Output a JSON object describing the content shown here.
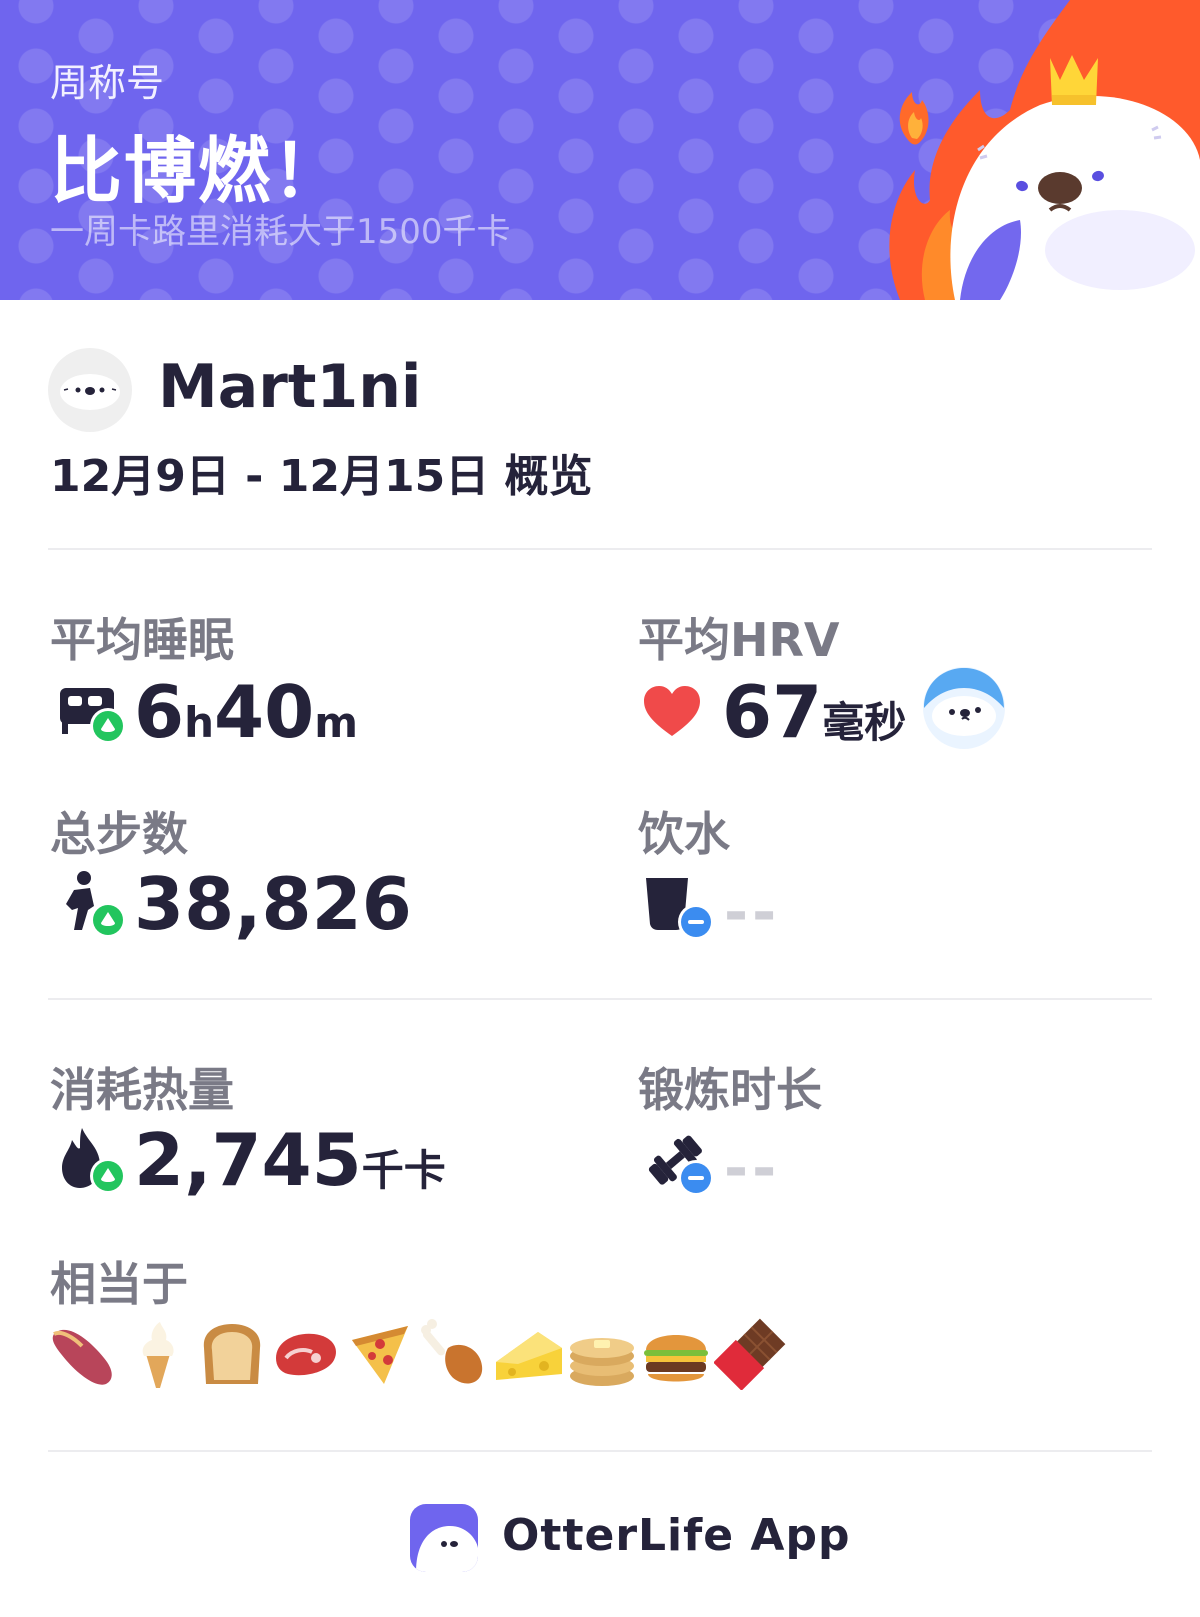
{
  "badge": {
    "kicker": "周称号",
    "title": "比博燃！",
    "description": "一周卡路里消耗大于1500千卡"
  },
  "profile": {
    "username": "Mart1ni",
    "date_range": "12月9日 - 12月15日 概览"
  },
  "stats": {
    "sleep": {
      "label": "平均睡眠",
      "h": "6",
      "h_unit": "h",
      "m": "40",
      "m_unit": "m",
      "trend_icon": "trend-up-badge"
    },
    "hrv": {
      "label": "平均HRV",
      "value": "67",
      "unit": "毫秒",
      "icon": "heart-icon"
    },
    "steps": {
      "label": "总步数",
      "value": "38,826",
      "trend_icon": "trend-up-badge"
    },
    "water": {
      "label": "饮水",
      "value": "--",
      "trend_icon": "neutral-badge"
    },
    "calories": {
      "label": "消耗热量",
      "value": "2,745",
      "unit": "千卡",
      "trend_icon": "trend-up-badge"
    },
    "workout": {
      "label": "锻炼时长",
      "value": "--",
      "trend_icon": "neutral-badge"
    }
  },
  "equivalent": {
    "label": "相当于",
    "foods": [
      "sweet-potato",
      "soft-ice-cream",
      "bread",
      "steak",
      "pizza",
      "chicken-leg",
      "cheese",
      "pancakes",
      "hamburger",
      "chocolate-bar"
    ]
  },
  "footer": {
    "app_name": "OtterLife App"
  },
  "colors": {
    "banner_bg": "#6f65ee",
    "text_dark": "#25233a",
    "label_gray": "#7a7a86",
    "trend_up_green": "#22c55e",
    "neutral_blue": "#3b8cf0",
    "heart_red": "#f04a4a"
  }
}
